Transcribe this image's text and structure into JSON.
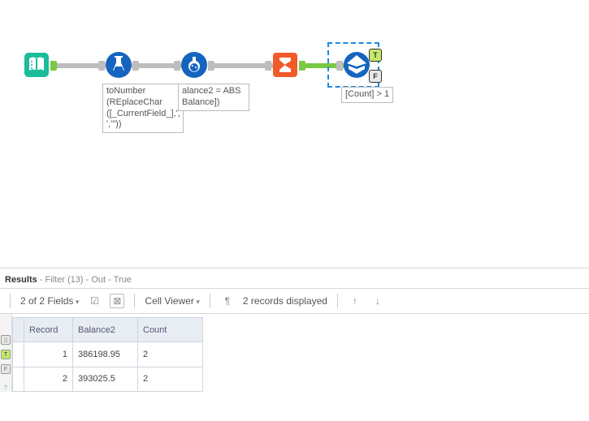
{
  "canvas": {
    "tools": {
      "input": {
        "name": "input-data-tool"
      },
      "multifield": {
        "name": "multi-field-formula-tool",
        "label": "toNumber\n(REplaceChar\n([_CurrentField_],',\n','\"))"
      },
      "formula": {
        "name": "formula-tool",
        "label": "alance2 = ABS\nBalance])"
      },
      "summarize": {
        "name": "summarize-tool"
      },
      "filter": {
        "name": "filter-tool",
        "label": "[Count] > 1",
        "anchor_t": "T",
        "anchor_f": "F"
      }
    }
  },
  "tabs": {
    "results": "Results",
    "filter": " - Filter (13)",
    "out": " - Out",
    "true": " - True"
  },
  "toolbar": {
    "fields": "2 of 2 Fields",
    "cell_viewer": "Cell Viewer",
    "records": "2 records displayed",
    "check": "☑",
    "close": "⊠",
    "para": "¶",
    "up": "↑",
    "down": "↓"
  },
  "grid": {
    "headers": {
      "record": "Record",
      "balance": "Balance2",
      "count": "Count"
    },
    "rows": [
      {
        "record": "1",
        "balance": "386198.95",
        "count": "2"
      },
      {
        "record": "2",
        "balance": "393025.5",
        "count": "2"
      }
    ]
  },
  "gutter": {
    "t": "T",
    "f": "F",
    "q": "?"
  }
}
